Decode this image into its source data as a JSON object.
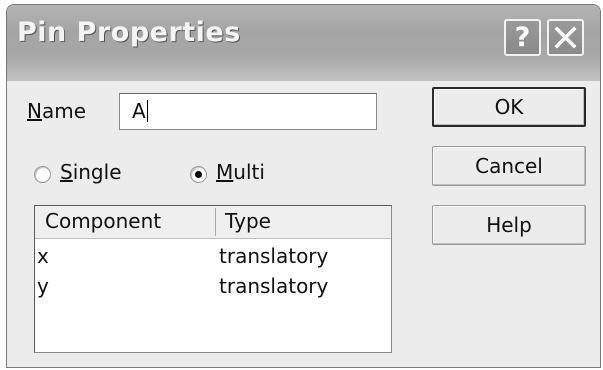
{
  "dialog": {
    "title": "Pin Properties",
    "help_glyph": "?",
    "close_icon": "close-icon"
  },
  "name": {
    "label_accel": "N",
    "label_rest": "ame",
    "value": "A"
  },
  "mode": {
    "single_accel": "S",
    "single_rest": "ingle",
    "multi_accel": "M",
    "multi_rest": "ulti",
    "selected": "Multi"
  },
  "table": {
    "columns": [
      "Component",
      "Type"
    ],
    "rows": [
      [
        "x",
        "translatory"
      ],
      [
        "y",
        "translatory"
      ]
    ]
  },
  "buttons": {
    "ok": "OK",
    "cancel": "Cancel",
    "help": "Help"
  },
  "colors": {
    "titlebar": "#a8a8a8",
    "face": "#ececec"
  }
}
